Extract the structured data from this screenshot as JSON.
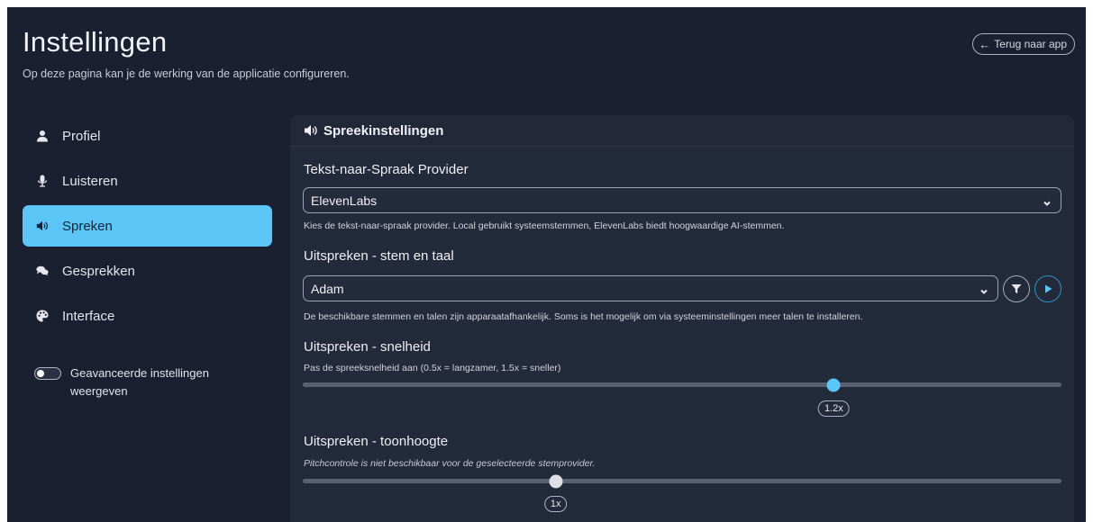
{
  "header": {
    "title": "Instellingen",
    "subtitle": "Op deze pagina kan je de werking van de applicatie configureren.",
    "back_label": "Terug naar app",
    "back_icon": "arrow-left-icon"
  },
  "sidebar": {
    "items": [
      {
        "label": "Profiel",
        "icon": "user-icon",
        "active": false
      },
      {
        "label": "Luisteren",
        "icon": "microphone-icon",
        "active": false
      },
      {
        "label": "Spreken",
        "icon": "speaker-icon",
        "active": true
      },
      {
        "label": "Gesprekken",
        "icon": "chat-bubbles-icon",
        "active": false
      },
      {
        "label": "Interface",
        "icon": "palette-icon",
        "active": false
      }
    ],
    "advanced_toggle": {
      "label": "Geavanceerde instellingen weergeven",
      "checked": false
    }
  },
  "panel": {
    "title": "Spreekinstellingen",
    "icon": "speaker-icon",
    "provider": {
      "label": "Tekst-naar-Spraak Provider",
      "value": "ElevenLabs",
      "help": "Kies de tekst-naar-spraak provider. Local gebruikt systeemstemmen, ElevenLabs biedt hoogwaardige AI-stemmen."
    },
    "voice": {
      "label": "Uitspreken - stem en taal",
      "value": "Adam",
      "help": "De beschikbare stemmen en talen zijn apparaatafhankelijk. Soms is het mogelijk om via systeeminstellingen meer talen te installeren."
    },
    "speed": {
      "label": "Uitspreken - snelheid",
      "help": "Pas de spreeksnelheid aan (0.5x = langzamer, 1.5x = sneller)",
      "value": 1.2,
      "min": 0.5,
      "max": 1.5,
      "value_label": "1.2x"
    },
    "pitch": {
      "label": "Uitspreken - toonhoogte",
      "help": "Pitchcontrole is niet beschikbaar voor de geselecteerde stemprovider.",
      "value": 1,
      "min": 0.5,
      "max": 2,
      "value_label": "1x"
    }
  },
  "colors": {
    "background": "#1b2030",
    "panel": "#232a3a",
    "accent": "#5bc6f6"
  }
}
